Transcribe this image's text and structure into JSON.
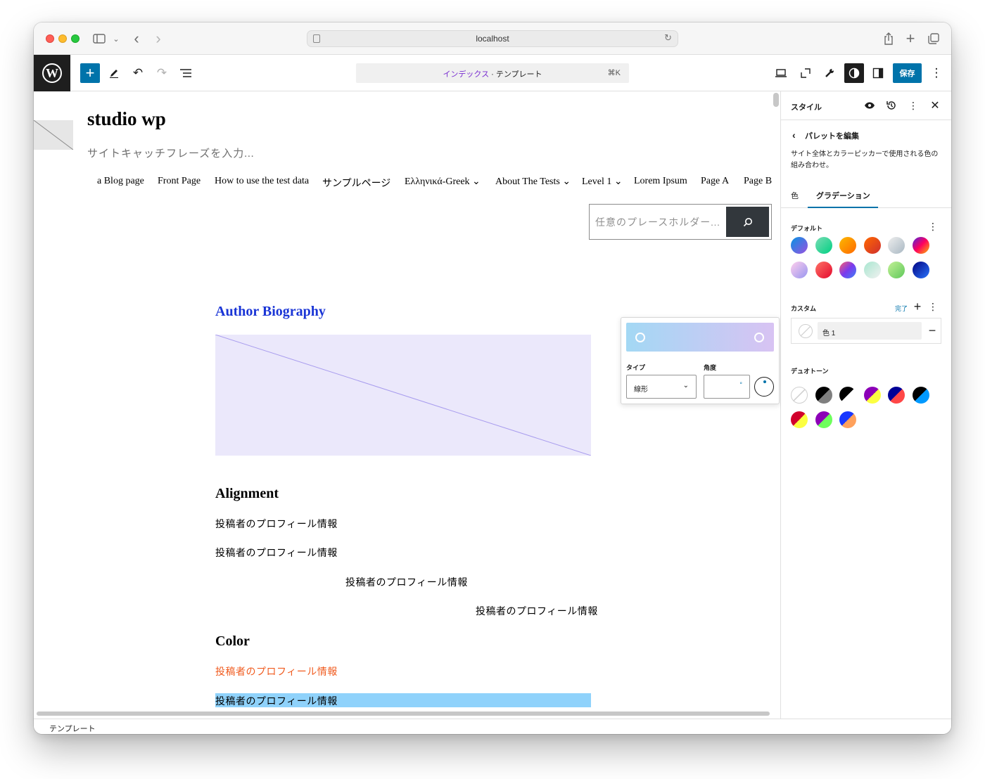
{
  "browser": {
    "url": "localhost"
  },
  "toolbar": {
    "doc_title_accent": "インデックス",
    "doc_title_rest": " · テンプレート",
    "shortcut": "⌘K",
    "save_label": "保存"
  },
  "site": {
    "title": "studio wp",
    "tagline": "サイトキャッチフレーズを入力...",
    "nav": [
      "a Blog page",
      "Front Page",
      "How to use the test data",
      "サンプルページ",
      "Ελληνικά-Greek ⌄",
      "About The Tests ⌄",
      "Level 1 ⌄",
      "Lorem Ipsum",
      "Page A",
      "Page B"
    ],
    "search_placeholder": "任意のプレースホルダー..."
  },
  "content": {
    "bio_title": "Author Biography",
    "alignment_heading": "Alignment",
    "color_heading": "Color",
    "para_text": "投稿者のプロフィール情報",
    "para_text_2": "投稿者のプロフィール情報",
    "para_text_3": "投稿者のプロフィール情報",
    "para_text_4": "投稿者のプロフィール情報",
    "para_text_5": "投稿者のプロフィール情報",
    "para_text_6": "投稿者のプロフィール情報"
  },
  "popover": {
    "type_label": "タイプ",
    "angle_label": "角度",
    "type_value": "線形",
    "angle_unit": "°",
    "gradient_start": "#a3d8f4",
    "gradient_end": "#d8c3f3"
  },
  "sidebar": {
    "title": "スタイル",
    "back_label": "パレットを編集",
    "description": "サイト全体とカラーピッカーで使用される色の組み合わせ。",
    "tab_color": "色",
    "tab_gradient": "グラデーション",
    "default_label": "デフォルト",
    "custom_label": "カスタム",
    "done_label": "完了",
    "custom_item_name": "色 1",
    "duotone_label": "デュオトーン",
    "default_gradients": [
      "linear-gradient(135deg,#0693e3,#9b51e0)",
      "linear-gradient(135deg,#7adcb4,#00d082)",
      "linear-gradient(135deg,#fcb900,#ff6900)",
      "linear-gradient(135deg,#ff6900,#cf2e2e)",
      "linear-gradient(135deg,#eeeeee,#a9b8c3)",
      "linear-gradient(135deg,#4a25e1,#ff005f,#fcb900)",
      "linear-gradient(135deg,#ffceec,#9896f0)",
      "linear-gradient(135deg,#fe7266,#e40a2e)",
      "linear-gradient(135deg,#ff5f6d,#7c3aed,#3b82f6)",
      "linear-gradient(135deg,#a8e6cf,#f1f1f1)",
      "linear-gradient(135deg,#c3f196,#5fc85a)",
      "linear-gradient(135deg,#020381,#2874fc)"
    ],
    "duotones": [
      [
        "#ffffff",
        "#ffffff"
      ],
      [
        "#000000",
        "#7f7f7f"
      ],
      [
        "#000000",
        "#ffffff"
      ],
      [
        "#8c00b7",
        "#fcff41"
      ],
      [
        "#000097",
        "#ff4747"
      ],
      [
        "#000000",
        "#0099ff"
      ],
      [
        "#d1002c",
        "#fcff41"
      ],
      [
        "#8c00b7",
        "#6eff5c"
      ],
      [
        "#1937ff",
        "#ffa15c"
      ]
    ]
  },
  "footer": {
    "label": "テンプレート"
  }
}
